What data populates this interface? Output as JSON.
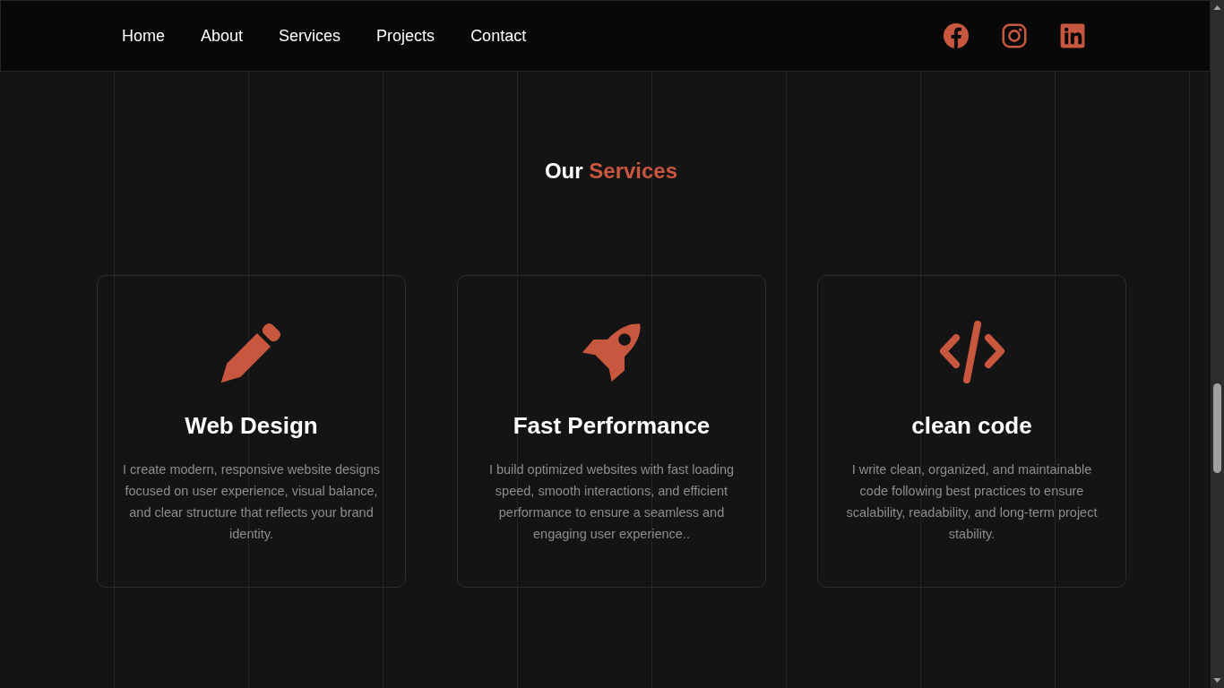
{
  "nav": {
    "links": [
      {
        "label": "Home"
      },
      {
        "label": "About"
      },
      {
        "label": "Services"
      },
      {
        "label": "Projects"
      },
      {
        "label": "Contact"
      }
    ]
  },
  "section_title": {
    "lead": "Our",
    "accent": "Services"
  },
  "services": [
    {
      "title": "Web Design",
      "description": "I create modern, responsive website designs focused on user experience, visual balance, and clear structure that reflects your brand identity."
    },
    {
      "title": "Fast Performance",
      "description": "I build optimized websites with fast loading speed, smooth interactions, and efficient performance to ensure a seamless and engaging user experience.."
    },
    {
      "title": "clean code",
      "description": "I write clean, organized, and maintainable code following best practices to ensure scalability, readability, and long-term project stability."
    }
  ]
}
